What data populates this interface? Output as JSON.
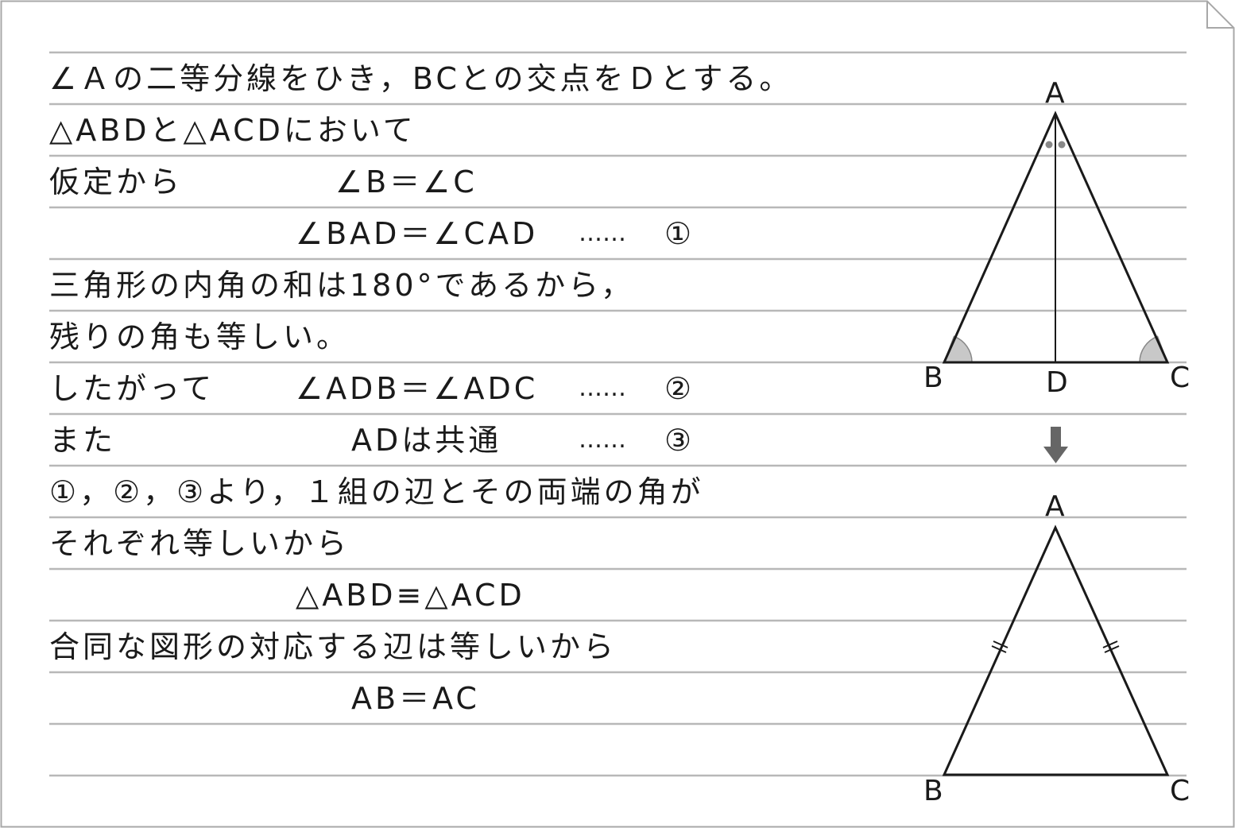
{
  "proof": {
    "lines": [
      {
        "text": "∠Ａの二等分線をひき，BCとの交点をＤとする。"
      },
      {
        "text": "△ABDと△ACDにおいて"
      },
      {
        "text": "仮定から"
      },
      {
        "text": "∠B＝∠C"
      },
      {
        "text": "∠BAD＝∠CAD"
      },
      {
        "text": "……"
      },
      {
        "text": "①"
      },
      {
        "text": "三角形の内角の和は180°であるから，"
      },
      {
        "text": "残りの角も等しい。"
      },
      {
        "text": "したがって"
      },
      {
        "text": "∠ADB＝∠ADC"
      },
      {
        "text": "……"
      },
      {
        "text": "②"
      },
      {
        "text": "また"
      },
      {
        "text": "ADは共通"
      },
      {
        "text": "……"
      },
      {
        "text": "③"
      },
      {
        "text": "①，②，③より，１組の辺とその両端の角が"
      },
      {
        "text": "それぞれ等しいから"
      },
      {
        "text": "△ABD≡△ACD"
      },
      {
        "text": "合同な図形の対応する辺は等しいから"
      },
      {
        "text": "AB＝AC"
      }
    ]
  },
  "figure_top": {
    "labels": {
      "A": "A",
      "B": "B",
      "C": "C",
      "D": "D"
    }
  },
  "figure_bottom": {
    "labels": {
      "A": "A",
      "B": "B",
      "C": "C"
    }
  },
  "colors": {
    "rule_line": "#b8b8b8",
    "border": "#a8a8a8",
    "ink": "#1a1a1a",
    "angle_fill": "#c8c8c8",
    "arrow": "#666666"
  }
}
